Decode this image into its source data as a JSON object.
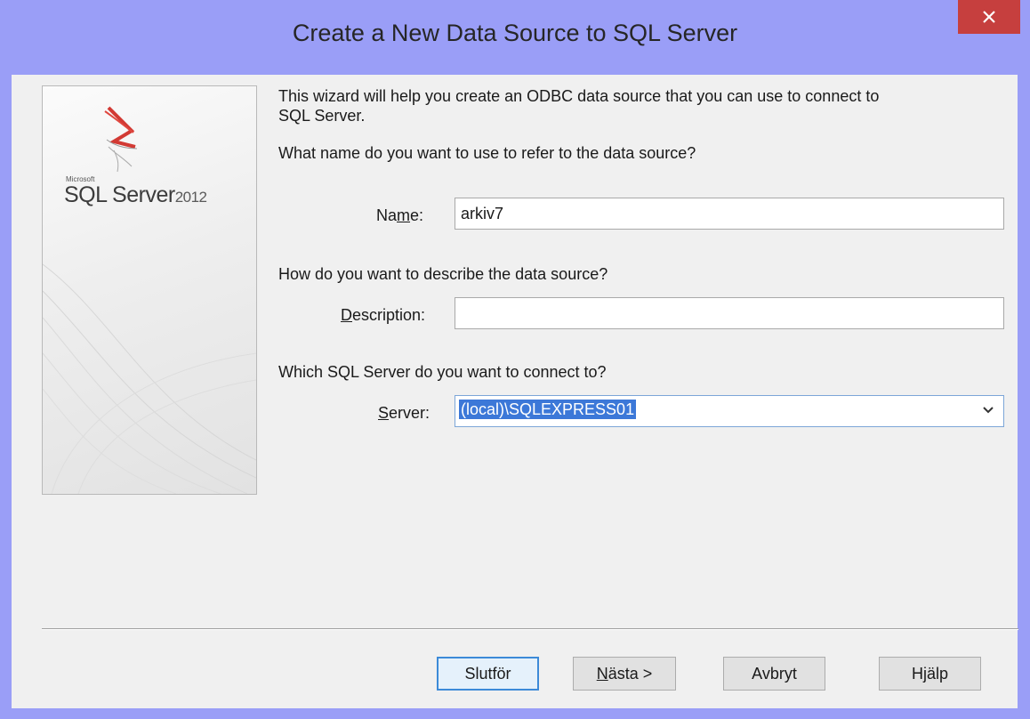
{
  "window": {
    "title": "Create a New Data Source to SQL Server",
    "close_icon": "close-icon"
  },
  "branding": {
    "vendor": "Microsoft",
    "product": "SQL Server",
    "year": "2012"
  },
  "intro": {
    "line1": "This wizard will help you create an ODBC data source that you can use to connect to",
    "line2": "SQL Server."
  },
  "name_section": {
    "question": "What name do you want to use to refer to the data source?",
    "label_pre": "Na",
    "label_accel": "m",
    "label_post": "e:",
    "value": "arkiv7"
  },
  "description_section": {
    "question": "How do you want to describe the data source?",
    "label_accel": "D",
    "label_post": "escription:",
    "value": ""
  },
  "server_section": {
    "question": "Which SQL Server do you want to connect to?",
    "label_accel": "S",
    "label_post": "erver:",
    "value": "(local)\\SQLEXPRESS01"
  },
  "buttons": {
    "finish": "Slutför",
    "next_accel": "N",
    "next_post": "ästa >",
    "cancel": "Avbryt",
    "help": "Hjälp"
  },
  "colors": {
    "title_bar": "#9a9ef7",
    "close_button": "#c63f3e",
    "selection": "#3c78d8",
    "default_button_border": "#3c8ad8"
  }
}
